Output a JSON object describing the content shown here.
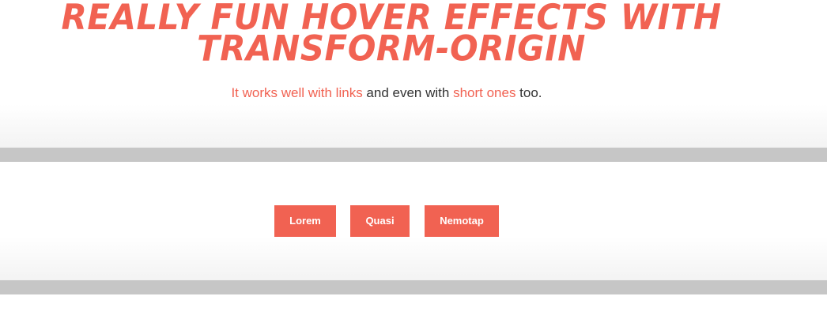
{
  "heading": {
    "line1": "REALLY FUN HOVER EFFECTS WITH",
    "line2": "TRANSFORM-ORIGIN"
  },
  "tagline": {
    "link1": "It works well with links",
    "text1": " and even with ",
    "link2": "short ones",
    "text2": " too."
  },
  "buttons": [
    {
      "label": "Lorem"
    },
    {
      "label": "Quasi"
    },
    {
      "label": "Nemotap"
    }
  ],
  "colors": {
    "accent": "#f16252",
    "divider": "#c6c6c6",
    "text": "#333333",
    "background": "#ffffff"
  }
}
